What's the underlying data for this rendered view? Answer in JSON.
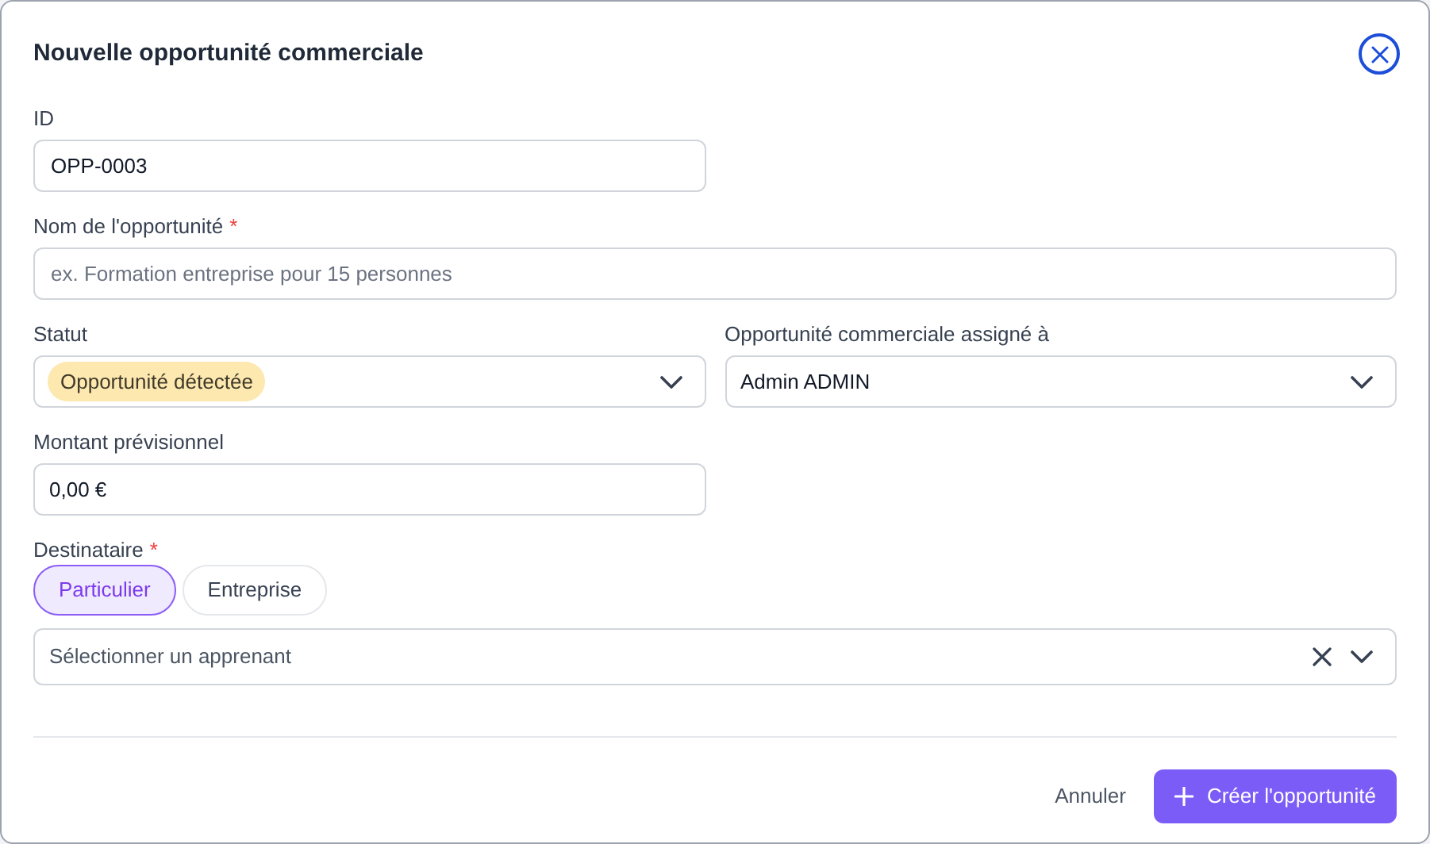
{
  "dialog": {
    "title": "Nouvelle opportunité commerciale"
  },
  "fields": {
    "id": {
      "label": "ID",
      "value": "OPP-0003"
    },
    "name": {
      "label": "Nom de l'opportunité",
      "required_mark": "*",
      "placeholder": "ex. Formation entreprise pour 15 personnes"
    },
    "status": {
      "label": "Statut",
      "value": "Opportunité détectée",
      "color": "#fde8b0"
    },
    "assignee": {
      "label": "Opportunité commerciale assigné à",
      "value": "Admin ADMIN"
    },
    "amount": {
      "label": "Montant prévisionnel",
      "value": "0,00 €"
    },
    "recipient": {
      "label": "Destinataire",
      "required_mark": "*",
      "options": [
        {
          "label": "Particulier",
          "selected": true
        },
        {
          "label": "Entreprise",
          "selected": false
        }
      ],
      "placeholder": "Sélectionner un apprenant"
    }
  },
  "buttons": {
    "cancel": "Annuler",
    "submit": "Créer l'opportunité"
  }
}
